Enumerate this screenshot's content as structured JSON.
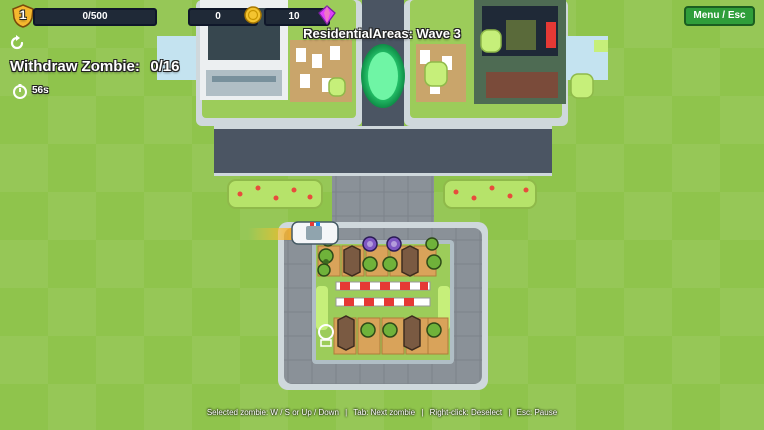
{
  "hud": {
    "level": "1",
    "xp_text": "0/500",
    "xp_fraction": 0.0,
    "coins": "0",
    "gems": "10",
    "menu_label": "Menu / Esc",
    "wave_title": "ResidentialAreas: Wave 3",
    "objective_label": "Withdraw Zombie:",
    "objective_count": "0/16",
    "objective_fraction": 0.0,
    "timer": "56s"
  },
  "controls_hint": [
    "Selected zombie: W / S or Up / Down",
    "Tab: Next zombie",
    "Right-click: Deselect",
    "Esc: Pause"
  ],
  "colors": {
    "grass": "#8fc44c",
    "road": "#4b5563",
    "sidewalk": "#cfd8dc",
    "hedge": "#b6e36a",
    "portal": "#2ee07a",
    "menu_button": "#2f9e3a",
    "zombie_skin": "#6fb23a",
    "coin": "#f4c430",
    "gem": "#e040fb"
  },
  "icons": {
    "level": "shield-badge-icon",
    "coin": "gold-coin-icon",
    "gem": "pink-gem-icon",
    "restart": "restart-arrow-icon",
    "timer": "stopwatch-icon"
  }
}
